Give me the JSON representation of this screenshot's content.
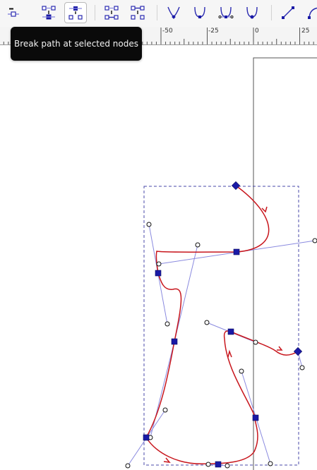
{
  "toolbar": {
    "buttons": [
      {
        "name": "delete-segment-button",
        "icon": "delete-segment-icon",
        "active": false
      },
      {
        "name": "join-nodes-button",
        "icon": "join-nodes-icon",
        "active": false
      },
      {
        "name": "break-path-button",
        "icon": "break-path-icon",
        "active": true
      },
      {
        "name": "join-with-segment-button",
        "icon": "join-segment-icon",
        "active": false
      },
      {
        "name": "split-path-button",
        "icon": "split-path-icon",
        "active": false
      },
      {
        "name": "make-cusp-button",
        "icon": "cusp-node-icon",
        "active": false
      },
      {
        "name": "make-smooth-button",
        "icon": "smooth-node-icon",
        "active": false
      },
      {
        "name": "make-symmetric-button",
        "icon": "symmetric-node-icon",
        "active": false
      },
      {
        "name": "make-auto-smooth-button",
        "icon": "auto-smooth-node-icon",
        "active": false
      },
      {
        "name": "make-line-button",
        "icon": "line-segment-icon",
        "active": false
      },
      {
        "name": "make-curve-button",
        "icon": "curve-segment-icon",
        "active": false
      }
    ]
  },
  "tooltip": {
    "text": "Break path at selected nodes"
  },
  "ruler": {
    "labels": [
      "-50",
      "-25",
      "0",
      "25"
    ]
  },
  "colors": {
    "path": "#c8161d",
    "handle": "#8a8adf",
    "node": "#1a1aa6",
    "bbox": "#4a4aa8",
    "page_border": "#555555",
    "toolbar_icon": "#2a2ab0"
  }
}
